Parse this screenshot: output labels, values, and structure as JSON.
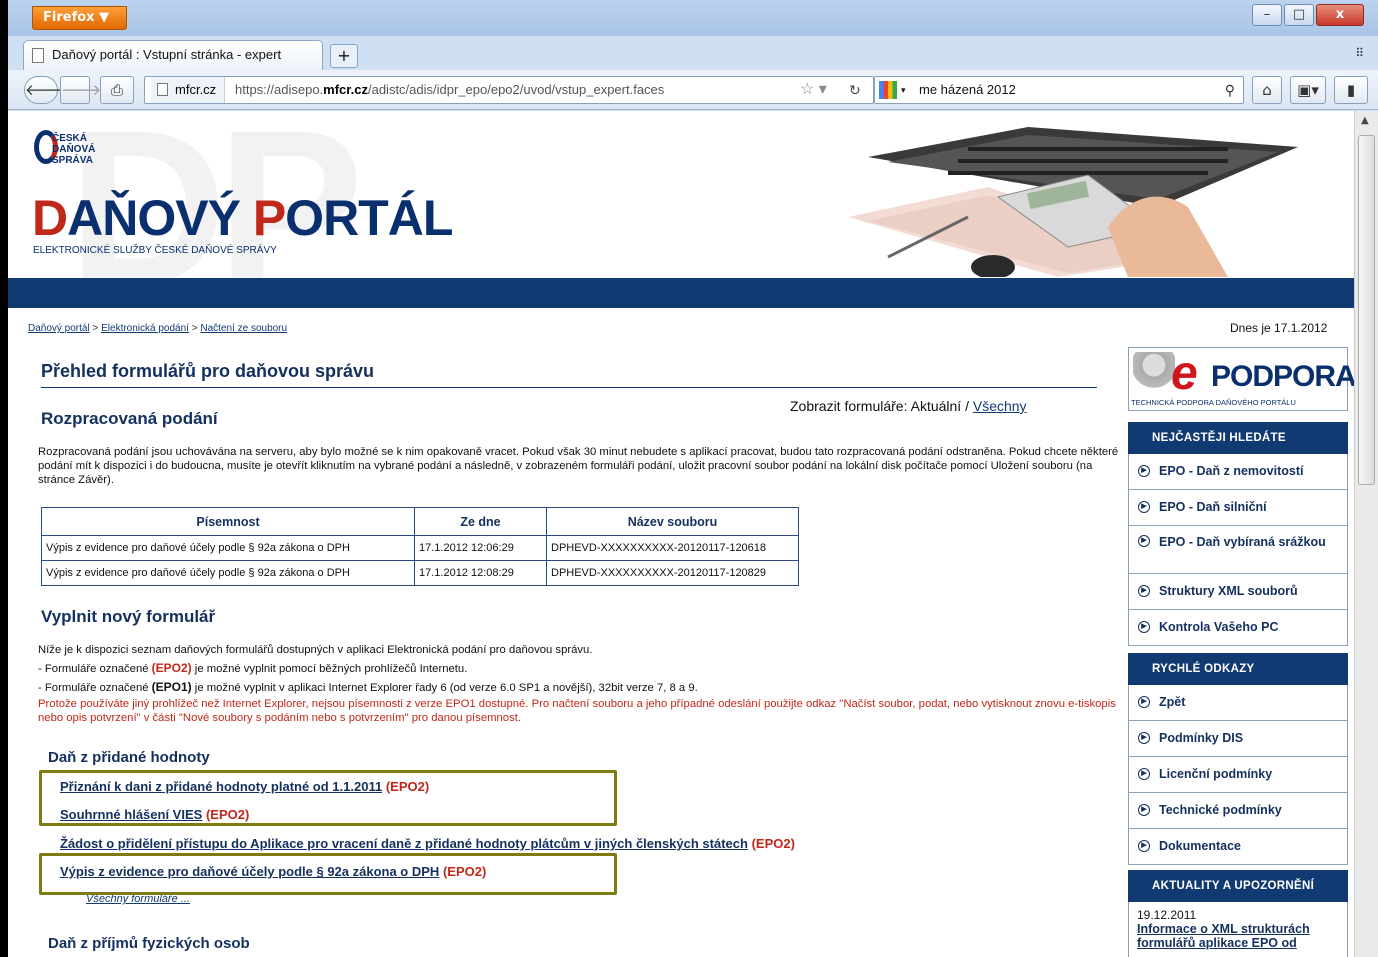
{
  "browser": {
    "menu_label": "Firefox ▼",
    "tab_title": "Daňový portál : Vstupní stránka - expert",
    "new_tab_label": "+",
    "url_site": "mfcr.cz",
    "url_prefix": "https://adisepo.",
    "url_domain": "mfcr.cz",
    "url_path": "/adistc/adis/idpr_epo/epo2/uvod/vstup_expert.faces",
    "search_value": "me házená 2012",
    "min_label": "–",
    "max_label": "□",
    "close_label": "x"
  },
  "header": {
    "logo_lines": [
      "ČESKÁ",
      "DAŇOVÁ",
      "SPRÁVA"
    ],
    "title_d": "D",
    "title_mid": "AŇOVÝ ",
    "title_p": "P",
    "title_end": "ORTÁL",
    "subtitle": "ELEKTRONICKÉ SLUŽBY ČESKÉ DAŇOVÉ SPRÁVY"
  },
  "breadcrumb": {
    "items": [
      "Daňový portál",
      "Elektronická podání",
      "Načtení ze souboru"
    ],
    "sep": " > "
  },
  "today": "Dnes je 17.1.2012",
  "main": {
    "overview_title": "Přehled formulářů pro daňovou správu",
    "show_forms_label": "Zobrazit formuláře: Aktuální / ",
    "show_forms_all": "Všechny",
    "drafts_title": "Rozpracovaná podání",
    "drafts_text": "Rozpracovaná podání jsou uchovávána na serveru, aby bylo možné se k nim opakovaně vracet. Pokud však 30 minut nebudete s aplikací pracovat, budou tato rozpracovaná podání odstraněna. Pokud chcete některé podání mít k dispozici i do budoucna, musíte je otevřít kliknutím na vybrané podání a následně, v zobrazeném formuláři podání, uložit pracovní soubor podání na lokální disk počítače pomocí Uložení souboru (na stránce Závěr).",
    "table": {
      "headers": [
        "Písemnost",
        "Ze dne",
        "Název souboru"
      ],
      "rows": [
        [
          "Výpis z evidence pro daňové účely podle § 92a zákona o DPH",
          "17.1.2012 12:06:29",
          "DPHEVD-XXXXXXXXXX-20120117-120618"
        ],
        [
          "Výpis z evidence pro daňové účely podle § 92a zákona o DPH",
          "17.1.2012 12:08:29",
          "DPHEVD-XXXXXXXXXX-20120117-120829"
        ]
      ]
    },
    "newform_title": "Vyplnit nový formulář",
    "intro_line1": "Níže je k dispozici seznam daňových formulářů dostupných v aplikaci Elektronická podání pro daňovou správu.",
    "intro_line2_a": "- Formuláře označené ",
    "intro_line2_tag": "(EPO2)",
    "intro_line2_b": " je možné vyplnit pomocí běžných prohlížečů Internetu.",
    "intro_line3_a": "- Formuláře označené ",
    "intro_line3_tag": "(EPO1)",
    "intro_line3_b": " je možné vyplnit v aplikaci Internet Explorer řady 6 (od verze 6.0 SP1 a novější), 32bit verze 7, 8 a 9.",
    "intro_warning": "Protože používáte jiný prohlížeč než Internet Explorer, nejsou písemnosti z verze EPO1 dostupné. Pro načtení souboru a jeho případné odeslání použijte odkaz \"Načíst soubor, podat, nebo vytisknout znovu e-tiskopis nebo opis potvrzení\" v části \"Nové soubory s podáním nebo s potvrzením\" pro danou písemnost.",
    "dph_title": "Daň z přidané hodnoty",
    "forms": [
      {
        "label": "Přiznání k dani z přidané hodnoty platné od 1.1.2011",
        "tag": "(EPO2)"
      },
      {
        "label": "Souhrnné hlášení VIES",
        "tag": "(EPO2)"
      },
      {
        "label": "Žádost o přidělení přístupu do Aplikace pro vracení daně z přidané hodnoty plátcům v jiných členských státech",
        "tag": "(EPO2)"
      },
      {
        "label": "Výpis z evidence pro daňové účely podle § 92a zákona o DPH",
        "tag": "(EPO2)"
      }
    ],
    "all_forms_label": "Všechny formuláře ...",
    "pfo_title": "Daň z příjmů fyzických osob"
  },
  "sidebar": {
    "epo_e": "e",
    "epo_word": "PODPORA",
    "epo_sub": "TECHNICKÁ PODPORA DAŇOVÉHO PORTÁLU",
    "faq_title": "NEJČASTĚJI HLEDÁTE",
    "faq_items": [
      "EPO - Daň z nemovitostí",
      "EPO - Daň silniční",
      "EPO - Daň vybíraná srážkou",
      "Struktury XML souborů",
      "Kontrola Vašeho PC"
    ],
    "quick_title": "RYCHLÉ ODKAZY",
    "quick_items": [
      "Zpět",
      "Podmínky DIS",
      "Licenční podmínky",
      "Technické podmínky",
      "Dokumentace"
    ],
    "news_title": "AKTUALITY A UPOZORNĚNÍ",
    "news_date": "19.12.2011",
    "news_link": "Informace o XML strukturách formulářů aplikace EPO od"
  },
  "colors": {
    "brand_blue": "#123a72",
    "brand_red": "#c0281a",
    "highlight_box": "#7d7a10"
  }
}
